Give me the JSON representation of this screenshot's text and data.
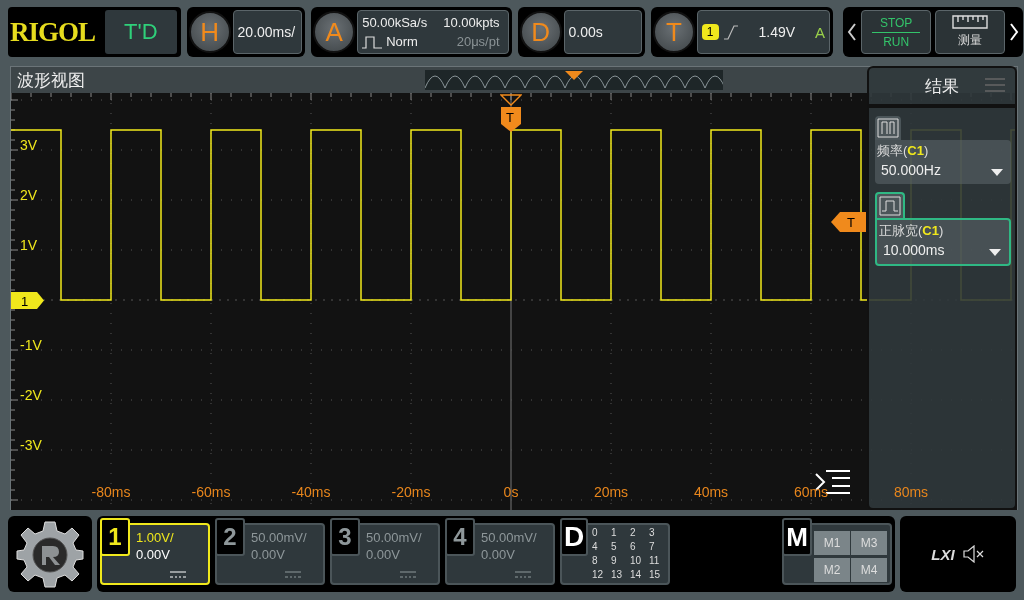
{
  "top_bar": {
    "logo": "RIGOL",
    "mode": "T'D",
    "horizontal": {
      "letter": "H",
      "scale": "20.00ms/"
    },
    "acquire": {
      "letter": "A",
      "sample_rate": "50.00kSa/s",
      "mode": "Norm",
      "memory_depth": "10.00kpts",
      "time_per_point": "20μs/pt"
    },
    "delay": {
      "letter": "D",
      "value": "0.00s"
    },
    "trigger": {
      "letter": "T",
      "source": "1",
      "level": "1.49V",
      "sweep": "A"
    },
    "controls": {
      "stop": "STOP",
      "run": "RUN",
      "measure": "测量"
    }
  },
  "waveform_view": {
    "title": "波形视图",
    "y_labels": [
      "3V",
      "2V",
      "1V",
      "-1V",
      "-2V",
      "-3V"
    ],
    "x_labels": [
      "-80ms",
      "-60ms",
      "-40ms",
      "-20ms",
      "0s",
      "20ms",
      "40ms",
      "60ms",
      "80ms"
    ],
    "channel_marker": "1",
    "trigger_marker": "T",
    "trigger_level_marker": "T"
  },
  "results": {
    "title": "结果",
    "items": [
      {
        "label": "频率(**C1**)",
        "value": "50.000Hz",
        "selected": false
      },
      {
        "label": "正脉宽(**C1**)",
        "value": "10.000ms",
        "selected": true
      }
    ]
  },
  "channels": [
    {
      "number": "1",
      "scale": "1.00V/",
      "offset": "0.00V",
      "active": true
    },
    {
      "number": "2",
      "scale": "50.00mV/",
      "offset": "0.00V",
      "active": false
    },
    {
      "number": "3",
      "scale": "50.00mV/",
      "offset": "0.00V",
      "active": false
    },
    {
      "number": "4",
      "scale": "50.00mV/",
      "offset": "0.00V",
      "active": false
    }
  ],
  "digital": {
    "letter": "D",
    "bits": [
      "0",
      "1",
      "2",
      "3",
      "4",
      "5",
      "6",
      "7",
      "8",
      "9",
      "10",
      "11",
      "12",
      "13",
      "14",
      "15"
    ]
  },
  "math": {
    "letter": "M",
    "slots": [
      "M1",
      "M3",
      "M2",
      "M4"
    ]
  },
  "status": {
    "lxi": "LXI"
  }
}
